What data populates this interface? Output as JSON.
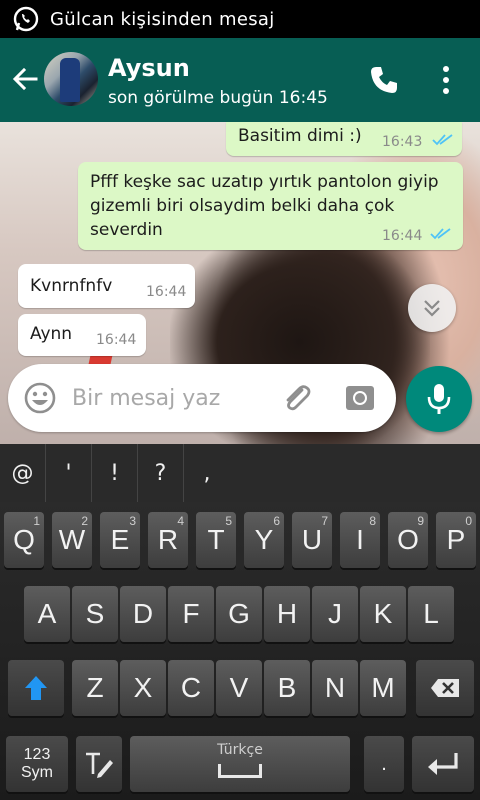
{
  "status_bar": {
    "notification_text": "Gülcan kişisinden mesaj"
  },
  "header": {
    "contact_name": "Aysun",
    "last_seen": "son görülme bugün 16:45"
  },
  "messages": [
    {
      "direction": "outgoing",
      "text": "Basitim dimi :)",
      "time": "16:43",
      "status": "read"
    },
    {
      "direction": "outgoing",
      "text": "Pfff keşke sac uzatıp yırtık pantolon giyip gizemli biri olsaydim belki daha çok severdin",
      "time": "16:44",
      "status": "read"
    },
    {
      "direction": "incoming",
      "text": "Kvnrnfnfv",
      "time": "16:44"
    },
    {
      "direction": "incoming",
      "text": "Aynn",
      "time": "16:44"
    }
  ],
  "composer": {
    "placeholder": "Bir mesaj yaz"
  },
  "keyboard": {
    "suggestions": [
      "@",
      "'",
      "!",
      "?",
      ","
    ],
    "row1": [
      {
        "key": "Q",
        "num": "1"
      },
      {
        "key": "W",
        "num": "2"
      },
      {
        "key": "E",
        "num": "3"
      },
      {
        "key": "R",
        "num": "4"
      },
      {
        "key": "T",
        "num": "5"
      },
      {
        "key": "Y",
        "num": "6"
      },
      {
        "key": "U",
        "num": "7"
      },
      {
        "key": "I",
        "num": "8"
      },
      {
        "key": "O",
        "num": "9"
      },
      {
        "key": "P",
        "num": "0"
      }
    ],
    "row2": [
      "A",
      "S",
      "D",
      "F",
      "G",
      "H",
      "J",
      "K",
      "L"
    ],
    "row3": [
      "Z",
      "X",
      "C",
      "V",
      "B",
      "N",
      "M"
    ],
    "sym_label_top": "123",
    "sym_label_bottom": "Sym",
    "space_label": "Türkçe",
    "period": "."
  },
  "colors": {
    "header": "#075e54",
    "accent": "#00897b",
    "outgoing_bubble": "#dcf8c6",
    "read_ticks": "#4fc3f7"
  }
}
